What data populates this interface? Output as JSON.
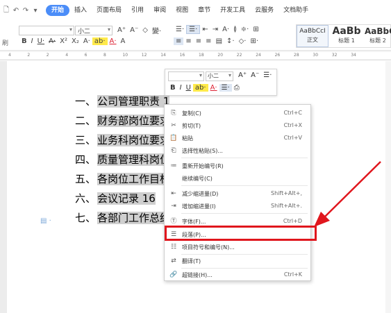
{
  "quick_access": [
    "🗋",
    "↶",
    "↷",
    "▾"
  ],
  "tabs": [
    "开始",
    "插入",
    "页面布局",
    "引用",
    "审阅",
    "视图",
    "章节",
    "开发工具",
    "云服务",
    "文档助手"
  ],
  "ribbon": {
    "left_label_1": "",
    "left_label_2": "刷",
    "font_name": "",
    "font_size": "小二",
    "row1": [
      "A⁺",
      "A⁻",
      "◇",
      "變·"
    ],
    "row2": [
      "B",
      "I",
      "U·",
      "A·",
      "X²",
      "X₂",
      "A·",
      "ab·",
      "A·",
      "A"
    ],
    "para_row1": [
      "☰·",
      "☰·",
      "⇤",
      "⇥",
      "A·",
      "≬",
      "≑·",
      "⊞"
    ],
    "para_row2": [
      "≡",
      "≡",
      "≡",
      "≡",
      "▤",
      "↕·",
      "◇·",
      "⊞·"
    ],
    "styles": [
      {
        "sample": "AaBbCcI",
        "name": "正文"
      },
      {
        "sample": "AaBb",
        "name": "标题 1"
      },
      {
        "sample": "AaBbC",
        "name": "标题 2"
      }
    ]
  },
  "ruler_marks": [
    "4",
    "2",
    "2",
    "4",
    "6",
    "8",
    "10",
    "12",
    "14",
    "16",
    "18",
    "20",
    "22",
    "24",
    "26",
    "28",
    "30",
    "32",
    "34"
  ],
  "document": {
    "lines": [
      {
        "num": "一、",
        "text": "公司管理职责 1"
      },
      {
        "num": "二、",
        "text": "财务部岗位要求"
      },
      {
        "num": "三、",
        "text": "业务科岗位要求"
      },
      {
        "num": "四、",
        "text": "质量管理科岗位"
      },
      {
        "num": "五、",
        "text": "各岗位工作目标"
      },
      {
        "num": "六、",
        "text": "会议记录 16"
      },
      {
        "num": "七、",
        "text": "各部门工作总结"
      }
    ]
  },
  "mini_toolbar": {
    "font_name": "",
    "font_size": "小二",
    "row1": [
      "A⁺",
      "A⁻",
      "☰·"
    ],
    "row2": [
      "B",
      "I",
      "U",
      "ab·",
      "A·",
      "☰·",
      "⎙"
    ]
  },
  "context_menu": {
    "items": [
      {
        "icon": "copy-icon",
        "glyph": "⎘",
        "label": "复制(C)",
        "shortcut": "Ctrl+C"
      },
      {
        "icon": "cut-icon",
        "glyph": "✂",
        "label": "剪切(T)",
        "shortcut": "Ctrl+X"
      },
      {
        "icon": "paste-icon",
        "glyph": "📋",
        "label": "粘贴",
        "shortcut": "Ctrl+V"
      },
      {
        "icon": "paste-special-icon",
        "glyph": "⎗",
        "label": "选择性粘贴(S)...",
        "shortcut": ""
      },
      {
        "icon": "restart-numbering-icon",
        "glyph": "≔",
        "label": "重新开始编号(R)",
        "shortcut": ""
      },
      {
        "icon": "",
        "glyph": "",
        "label": "继续编号(C)",
        "shortcut": ""
      },
      {
        "icon": "decrease-indent-icon",
        "glyph": "⇤",
        "label": "减少缩进量(D)",
        "shortcut": "Shift+Alt+,"
      },
      {
        "icon": "increase-indent-icon",
        "glyph": "⇥",
        "label": "增加缩进量(I)",
        "shortcut": "Shift+Alt+."
      },
      {
        "icon": "font-icon",
        "glyph": "Ⓣ",
        "label": "字体(F)...",
        "shortcut": "Ctrl+D"
      },
      {
        "icon": "paragraph-icon",
        "glyph": "☰",
        "label": "段落(P)...",
        "shortcut": ""
      },
      {
        "icon": "bullets-numbering-icon",
        "glyph": "☷",
        "label": "项目符号和编号(N)...",
        "shortcut": ""
      },
      {
        "icon": "translate-icon",
        "glyph": "⇄",
        "label": "翻译(T)",
        "shortcut": ""
      },
      {
        "icon": "hyperlink-icon",
        "glyph": "🔗",
        "label": "超链接(H)...",
        "shortcut": "Ctrl+K"
      }
    ]
  },
  "colors": {
    "active_tab": "#4b8df8",
    "highlight_border": "#e0161d",
    "arrow": "#e0161d",
    "selection": "#cfcfcf"
  }
}
